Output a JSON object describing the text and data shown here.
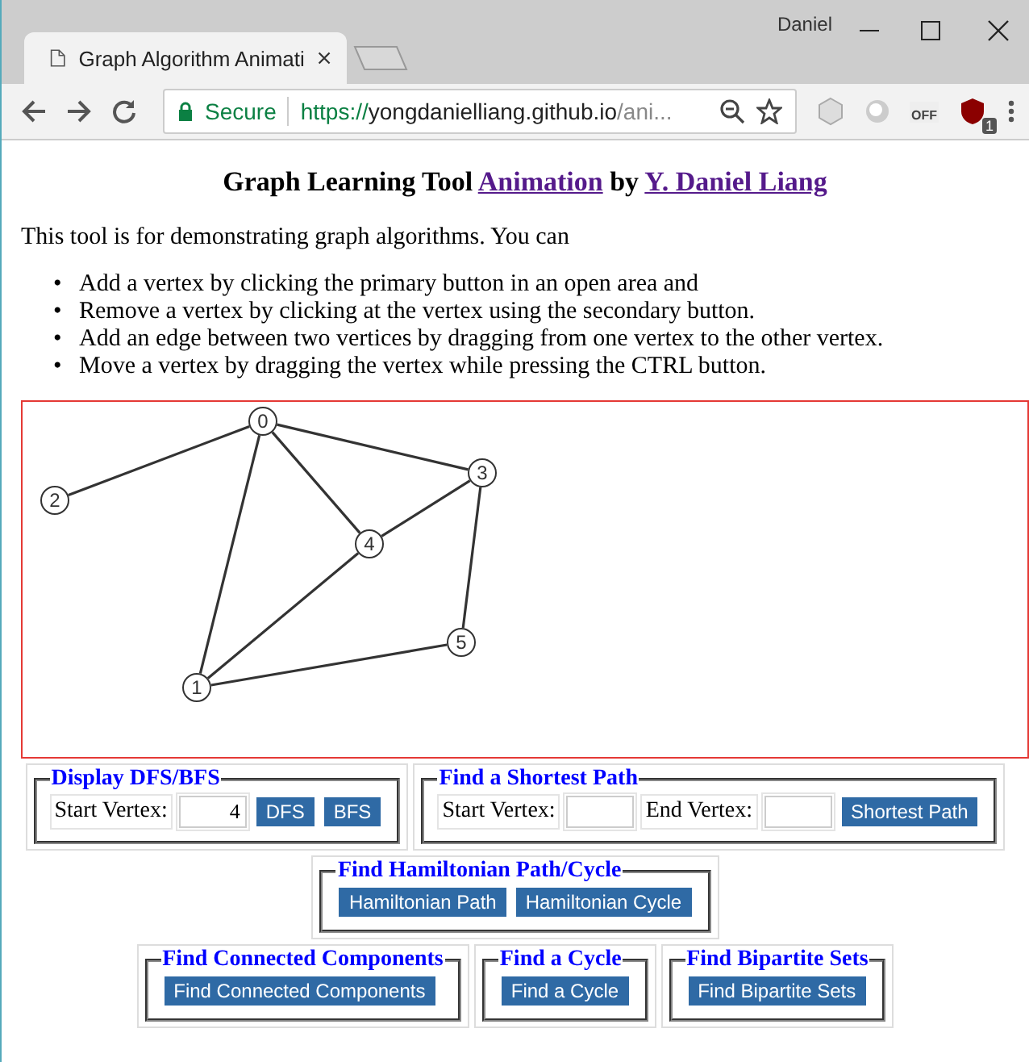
{
  "browser": {
    "profile": "Daniel",
    "tabs": [
      {
        "title": "Graph Algorithm Animati",
        "selected": true
      }
    ],
    "url": {
      "secure_label": "Secure",
      "scheme": "https://",
      "host": "yongdanielliang.github.io",
      "path": "/ani..."
    },
    "extension_badge": "1",
    "extension_off_label": "OFF"
  },
  "heading": {
    "title": "Graph Learning Tool",
    "link1": "Animation",
    "by": "by",
    "link2": "Y. Daniel Liang"
  },
  "intro": "This tool is for demonstrating graph algorithms. You can",
  "instructions": [
    {
      "bullet": "•",
      "text": "Add a vertex by clicking the primary button in an open area and"
    },
    {
      "bullet": "•",
      "text": "Remove a vertex by clicking at the vertex using the secondary button."
    },
    {
      "bullet": "•",
      "text": "Add an edge between two vertices by dragging from one vertex to the other vertex."
    },
    {
      "bullet": "•",
      "text": "Move a vertex by dragging the vertex while pressing the CTRL button."
    }
  ],
  "graph": {
    "vertices": [
      {
        "label": "0"
      },
      {
        "label": "1"
      },
      {
        "label": "2"
      },
      {
        "label": "3"
      },
      {
        "label": "4"
      },
      {
        "label": "5"
      }
    ]
  },
  "panels": [
    {
      "legend": "Display DFS/BFS",
      "items": [
        {
          "kind": "label",
          "text": "Start Vertex:"
        },
        {
          "kind": "field",
          "value": "4"
        },
        {
          "kind": "button",
          "text": "DFS"
        },
        {
          "kind": "button",
          "text": "BFS"
        }
      ]
    },
    {
      "legend": "Find a Shortest Path",
      "items": [
        {
          "kind": "label",
          "text": "Start Vertex:"
        },
        {
          "kind": "field"
        },
        {
          "kind": "label",
          "text": "End Vertex:"
        },
        {
          "kind": "field"
        },
        {
          "kind": "button",
          "text": "Shortest Path"
        }
      ]
    },
    {
      "legend": "Find Hamiltonian Path/Cycle",
      "items": [
        {
          "kind": "button",
          "text": "Hamiltonian Path"
        },
        {
          "kind": "button",
          "text": "Hamiltonian Cycle"
        }
      ]
    },
    {
      "legend": "Find Connected Components",
      "items": [
        {
          "kind": "button",
          "text": "Find Connected Components"
        }
      ]
    },
    {
      "legend": "Find a Cycle",
      "items": [
        {
          "kind": "button",
          "text": "Find a Cycle"
        }
      ]
    },
    {
      "legend": "Find Bipartite Sets",
      "items": [
        {
          "kind": "button",
          "text": "Find Bipartite Sets"
        }
      ]
    }
  ]
}
